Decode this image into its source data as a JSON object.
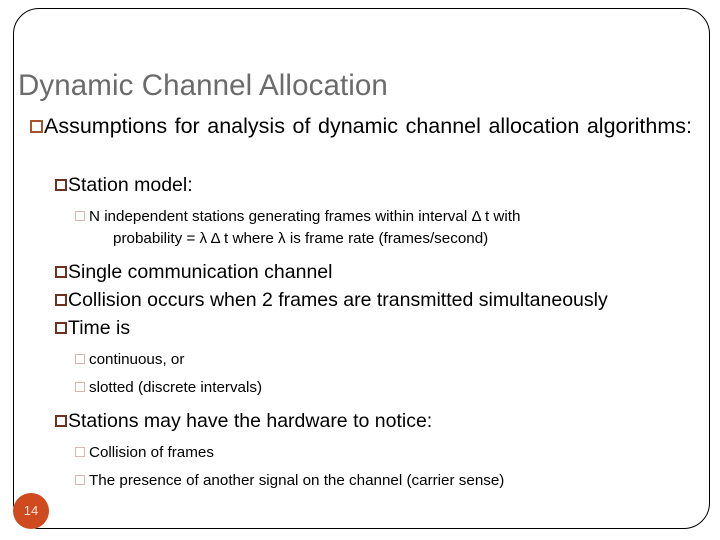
{
  "slide": {
    "title": "Dynamic Channel Allocation",
    "page_number": "14",
    "colors": {
      "title": "#6b6b6b",
      "bullet_level1": "#a6552b",
      "bullet_level2": "#6e3221",
      "bullet_level3": "#d2b9b0",
      "page_badge": "#cf4a1e",
      "page_badge_text": "#f5e4d5",
      "body_text": "#000000",
      "frame": "#000000"
    },
    "bullet_glyph": "hollow-square",
    "content": {
      "b1": "Assumptions for analysis of dynamic channel allocation algorithms:",
      "b1_1": "Station model:",
      "b1_1_1_line1": "N independent stations generating frames within interval Δ t with",
      "b1_1_1_line2": "probability = λ Δ t where λ is frame rate (frames/second)",
      "b1_2": "Single communication channel",
      "b1_3": "Collision occurs when 2 frames are transmitted simultaneously",
      "b1_4": "Time is",
      "b1_4_1": "continuous, or",
      "b1_4_2": "slotted (discrete intervals)",
      "b1_5": "Stations may have the hardware to notice:",
      "b1_5_1": "Collision of frames",
      "b1_5_2": "The presence of another signal on the channel (carrier sense)"
    }
  }
}
